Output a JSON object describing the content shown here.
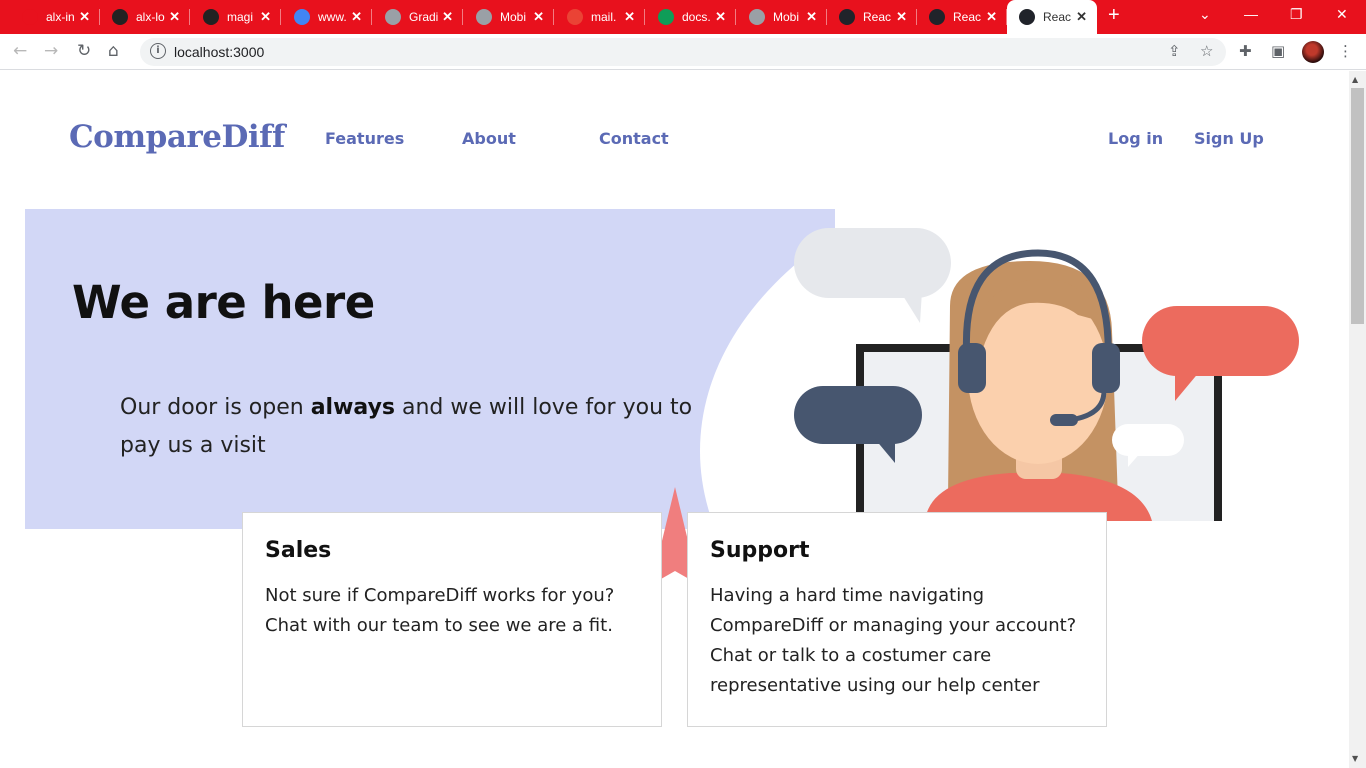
{
  "browser": {
    "tabs": [
      {
        "title": "alx-in",
        "favicon": "alx-icon",
        "color": "#e8111d"
      },
      {
        "title": "alx-lo",
        "favicon": "github-icon",
        "color": "#222222"
      },
      {
        "title": "magi",
        "favicon": "github-icon",
        "color": "#222222"
      },
      {
        "title": "www.",
        "favicon": "google-icon",
        "color": "#4285f4"
      },
      {
        "title": "Gradi",
        "favicon": "globe-icon",
        "color": "#9aa0a6"
      },
      {
        "title": "Mobi",
        "favicon": "globe-icon",
        "color": "#9aa0a6"
      },
      {
        "title": "mail.",
        "favicon": "gmail-icon",
        "color": "#ea4335"
      },
      {
        "title": "docs.",
        "favicon": "sheets-icon",
        "color": "#0f9d58"
      },
      {
        "title": "Mobi",
        "favicon": "globe-icon",
        "color": "#9aa0a6"
      },
      {
        "title": "Reac",
        "favicon": "react-icon",
        "color": "#20232a"
      },
      {
        "title": "Reac",
        "favicon": "react-icon",
        "color": "#20232a"
      },
      {
        "title": "Reac",
        "favicon": "react-icon",
        "color": "#20232a"
      }
    ],
    "new_tab": "+",
    "url": "localhost:3000"
  },
  "nav": {
    "logo": "CompareDiff",
    "features": "Features",
    "about": "About",
    "contact": "Contact",
    "login": "Log in",
    "signup": "Sign Up"
  },
  "hero": {
    "title": "We are here",
    "text_before": "Our door is open ",
    "text_bold": "always",
    "text_after": " and we will love for you to pay us a visit"
  },
  "cards": {
    "sales": {
      "title": "Sales",
      "line1": "Not sure if CompareDiff works for you?",
      "line2": "Chat with our team to see we are a fit."
    },
    "support": {
      "title": "Support",
      "line1": "Having a hard time navigating",
      "line2": "CompareDiff or managing your account?",
      "line3": "Chat or talk to a costumer care",
      "line4": "representative using our help center"
    }
  },
  "colors": {
    "brand": "#5b6ab5",
    "hero_bg": "#d2d7f6",
    "accent": "#f07e7e",
    "chrome": "#e8111d"
  }
}
